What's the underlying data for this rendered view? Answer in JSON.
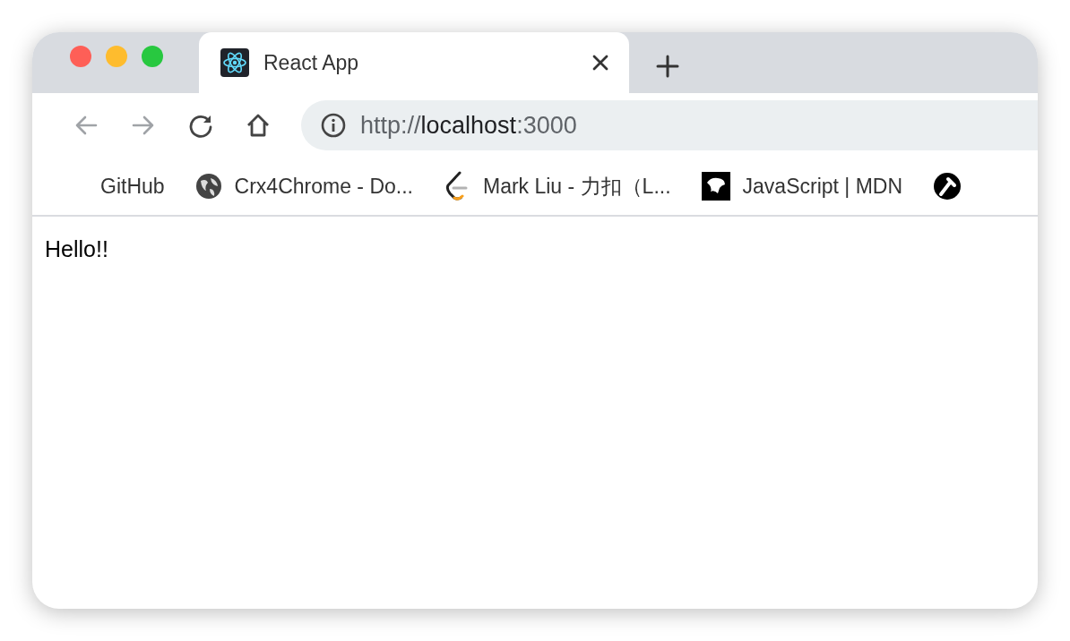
{
  "window": {
    "controls": [
      {
        "color": "#fe5f57"
      },
      {
        "color": "#febc2e"
      },
      {
        "color": "#28c840"
      }
    ]
  },
  "tabs": [
    {
      "title": "React App",
      "selected": true
    }
  ],
  "toolbar": {
    "back_disabled": true,
    "forward_disabled": true
  },
  "address_bar": {
    "scheme": "http://",
    "host": "localhost",
    "port": ":3000"
  },
  "bookmarks": [
    {
      "kind": "none",
      "label": "GitHub"
    },
    {
      "kind": "globe",
      "label": "Crx4Chrome - Do..."
    },
    {
      "kind": "leetcode",
      "label": "Mark Liu - 力扣（L..."
    },
    {
      "kind": "mdn",
      "label": "JavaScript | MDN"
    },
    {
      "kind": "tool"
    }
  ],
  "page": {
    "text": "Hello!!"
  }
}
